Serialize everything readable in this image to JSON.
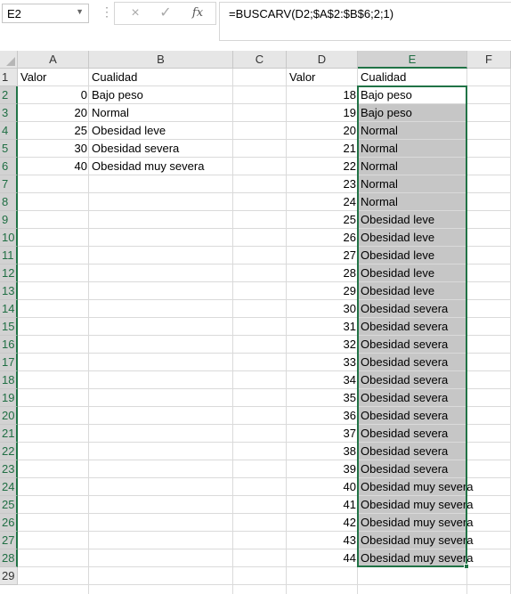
{
  "formula_bar": {
    "name_box": "E2",
    "cancel_icon": "×",
    "enter_icon": "✓",
    "fx_label": "fx",
    "formula": "=BUSCARV(D2;$A$2:$B$6;2;1)"
  },
  "columns": [
    "A",
    "B",
    "C",
    "D",
    "E",
    "F"
  ],
  "rows": [
    "1",
    "2",
    "3",
    "4",
    "5",
    "6",
    "7",
    "8",
    "9",
    "10",
    "11",
    "12",
    "13",
    "14",
    "15",
    "16",
    "17",
    "18",
    "19",
    "20",
    "21",
    "22",
    "23",
    "24",
    "25",
    "26",
    "27",
    "28",
    "29"
  ],
  "table_left": {
    "header": [
      "Valor",
      "Cualidad"
    ],
    "rows": [
      [
        "0",
        "Bajo peso"
      ],
      [
        "20",
        "Normal"
      ],
      [
        "25",
        "Obesidad leve"
      ],
      [
        "30",
        "Obesidad severa"
      ],
      [
        "40",
        "Obesidad muy severa"
      ]
    ]
  },
  "table_right": {
    "header": [
      "Valor",
      "Cualidad"
    ],
    "rows": [
      [
        "18",
        "Bajo peso"
      ],
      [
        "19",
        "Bajo peso"
      ],
      [
        "20",
        "Normal"
      ],
      [
        "21",
        "Normal"
      ],
      [
        "22",
        "Normal"
      ],
      [
        "23",
        "Normal"
      ],
      [
        "24",
        "Normal"
      ],
      [
        "25",
        "Obesidad leve"
      ],
      [
        "26",
        "Obesidad leve"
      ],
      [
        "27",
        "Obesidad leve"
      ],
      [
        "28",
        "Obesidad leve"
      ],
      [
        "29",
        "Obesidad leve"
      ],
      [
        "30",
        "Obesidad severa"
      ],
      [
        "31",
        "Obesidad severa"
      ],
      [
        "32",
        "Obesidad severa"
      ],
      [
        "33",
        "Obesidad severa"
      ],
      [
        "34",
        "Obesidad severa"
      ],
      [
        "35",
        "Obesidad severa"
      ],
      [
        "36",
        "Obesidad severa"
      ],
      [
        "37",
        "Obesidad severa"
      ],
      [
        "38",
        "Obesidad severa"
      ],
      [
        "39",
        "Obesidad severa"
      ],
      [
        "40",
        "Obesidad muy severa"
      ],
      [
        "41",
        "Obesidad muy severa"
      ],
      [
        "42",
        "Obesidad muy severa"
      ],
      [
        "43",
        "Obesidad muy severa"
      ],
      [
        "44",
        "Obesidad muy severa"
      ]
    ]
  },
  "colors": {
    "selection_border": "#217346",
    "selection_fill": "#c6c6c6",
    "header_bg": "#e6e6e6"
  }
}
